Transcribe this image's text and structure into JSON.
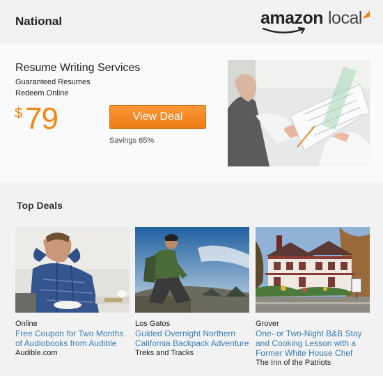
{
  "header": {
    "region": "National",
    "logo_word1": "amazon",
    "logo_word2": "local"
  },
  "hero": {
    "title": "Resume Writing Services",
    "subtitle_lines": [
      "Guaranteed Resumes",
      "Redeem Online"
    ],
    "price_currency": "$",
    "price_amount": "79",
    "button_label": "View Deal",
    "savings": "Savings 65%",
    "accent_color": "#f58612"
  },
  "top_deals": {
    "heading": "Top Deals",
    "cards": [
      {
        "location": "Online",
        "title": "Free Coupon for Two Months of Audiobooks from Audible",
        "merchant": "Audible.com"
      },
      {
        "location": "Los Gatos",
        "title": "Guided Overnight Northern California Backpack Adventure",
        "merchant": "Treks and Tracks"
      },
      {
        "location": "Grover",
        "title": "One- or Two-Night B&B Stay and Cooking Lesson with a Former White House Chef",
        "merchant": "The Inn of the Patriots"
      }
    ]
  },
  "colors": {
    "link": "#3b7cb0",
    "button": "#f58612",
    "page_background": "#f2f2f2"
  }
}
